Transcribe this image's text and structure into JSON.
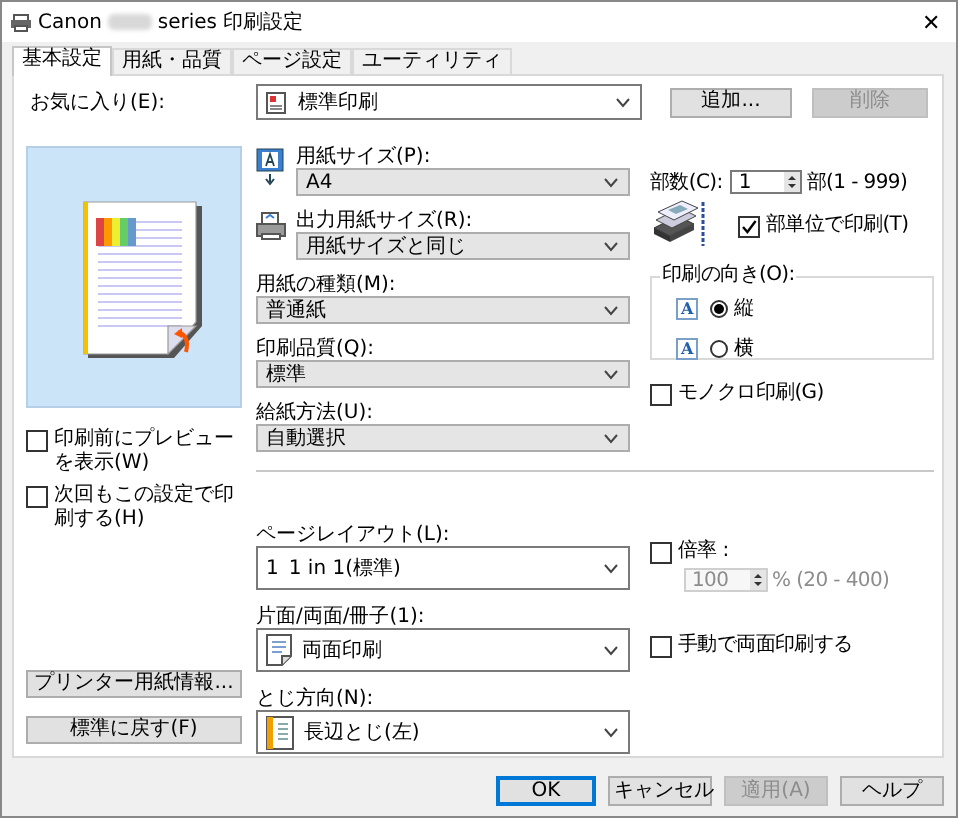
{
  "window": {
    "app_name": "Canon",
    "title": "series 印刷設定",
    "close": "✕"
  },
  "tabs": [
    {
      "label": "基本設定",
      "selected": true
    },
    {
      "label": "用紙・品質",
      "selected": false
    },
    {
      "label": "ページ設定",
      "selected": false
    },
    {
      "label": "ユーティリティ",
      "selected": false
    }
  ],
  "favorites": {
    "label": "お気に入り(E):",
    "value": "標準印刷"
  },
  "favorite_buttons": [
    {
      "label": "追加...",
      "disabled": false
    },
    {
      "label": "削除",
      "disabled": true
    }
  ],
  "preview_options": [
    {
      "label": "印刷前にプレビューを表示(W)",
      "checked": false
    },
    {
      "label": "次回もこの設定で印刷する(H)",
      "checked": false
    }
  ],
  "left_buttons": [
    {
      "label": "プリンター用紙情報..."
    },
    {
      "label": "標準に戻す(F)"
    }
  ],
  "paper_fields": [
    {
      "label": "用紙サイズ(P):",
      "value": "A4"
    },
    {
      "label": "出力用紙サイズ(R):",
      "value": "用紙サイズと同じ"
    },
    {
      "label": "用紙の種類(M):",
      "value": "普通紙"
    },
    {
      "label": "印刷品質(Q):",
      "value": "標準"
    },
    {
      "label": "給紙方法(U):",
      "value": "自動選択"
    }
  ],
  "copies": {
    "label": "部数(C):",
    "value": "1",
    "range": "部(1 - 999)"
  },
  "collate": {
    "label": "部単位で印刷(T)",
    "checked": true
  },
  "orientation": {
    "label": "印刷の向き(O):",
    "options": [
      {
        "icon_text": "A",
        "label": "縦",
        "selected": true
      },
      {
        "icon_text": "A",
        "label": "横",
        "selected": false
      }
    ]
  },
  "monochrome": {
    "label": "モノクロ印刷(G)",
    "checked": false
  },
  "layout_fields": [
    {
      "kind": "layout",
      "label": "ページレイアウト(L):",
      "icon_text": "1",
      "value": "1 in 1(標準)"
    },
    {
      "kind": "duplex",
      "label": "片面/両面/冊子(1):",
      "value": "両面印刷"
    },
    {
      "kind": "binding",
      "label": "とじ方向(N):",
      "value": "長辺とじ(左)"
    }
  ],
  "scaling": {
    "label": "倍率 :",
    "checked": false,
    "value": "100",
    "range": "% (20 - 400)",
    "disabled": true
  },
  "manual_duplex": {
    "label": "手動で両面印刷する",
    "checked": false
  },
  "buttons": [
    {
      "label": "OK",
      "default": true,
      "disabled": false
    },
    {
      "label": "キャンセル",
      "default": false,
      "disabled": false
    },
    {
      "label": "適用(A)",
      "default": false,
      "disabled": true
    },
    {
      "label": "ヘルプ",
      "default": false,
      "disabled": false
    }
  ]
}
